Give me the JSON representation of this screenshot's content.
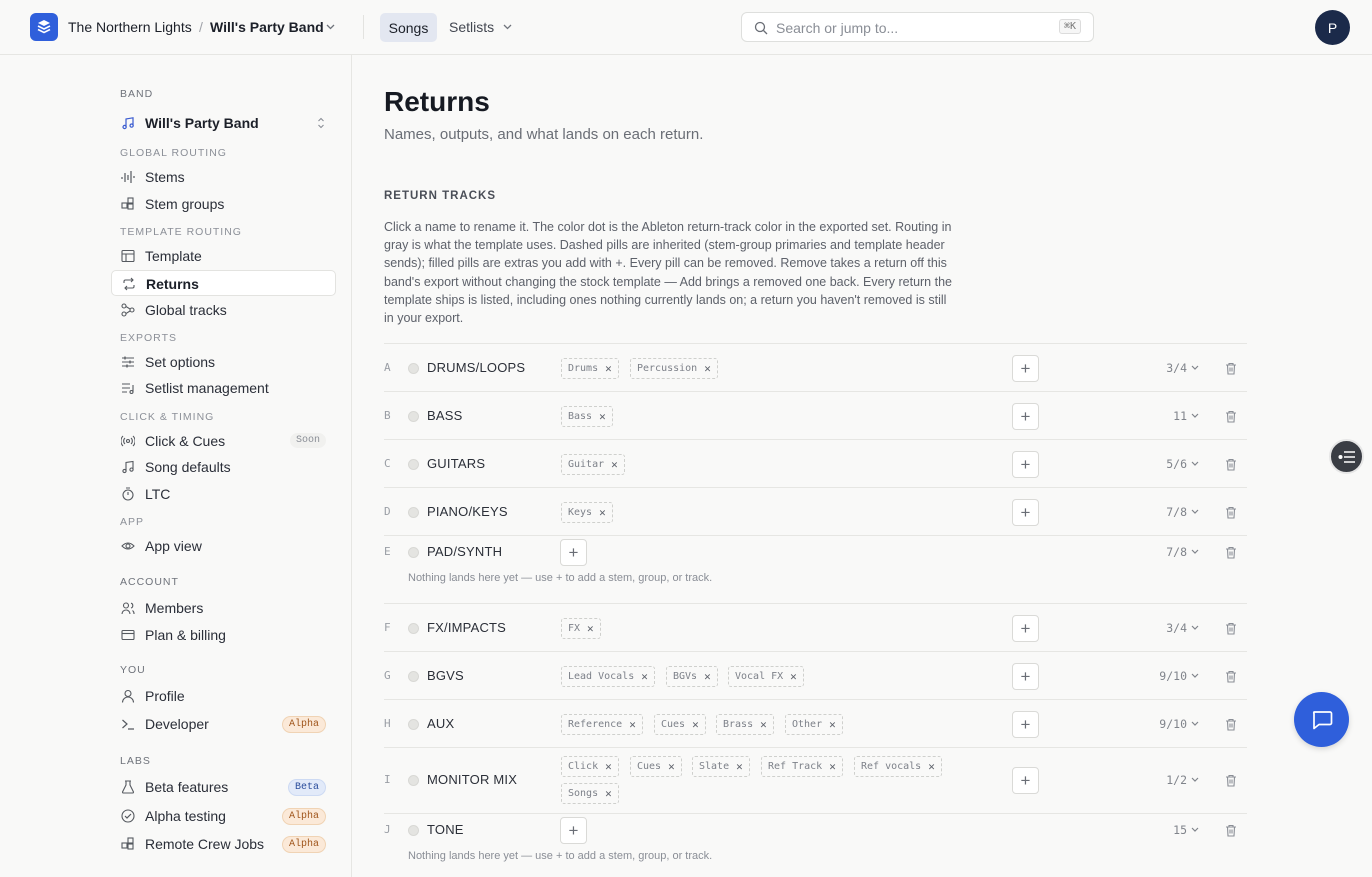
{
  "header": {
    "org": "The Northern Lights",
    "separator": "/",
    "band": "Will's Party Band",
    "tabs": [
      {
        "label": "Songs",
        "active": true
      },
      {
        "label": "Setlists",
        "active": false
      }
    ],
    "search_placeholder": "Search or jump to...",
    "search_shortcut": "⌘K",
    "avatar_initial": "P"
  },
  "sidebar": {
    "band_label": "BAND",
    "band_name": "Will's Party Band",
    "sections": {
      "global_routing": "GLOBAL ROUTING",
      "template_routing": "TEMPLATE ROUTING",
      "exports": "EXPORTS",
      "click_timing": "CLICK & TIMING",
      "app": "APP",
      "account": "ACCOUNT",
      "you": "YOU",
      "labs": "LABS"
    },
    "items": {
      "stems": "Stems",
      "stem_groups": "Stem groups",
      "template": "Template",
      "returns": "Returns",
      "global_tracks": "Global tracks",
      "set_options": "Set options",
      "setlist_management": "Setlist management",
      "click_cues": "Click & Cues",
      "song_defaults": "Song defaults",
      "ltc": "LTC",
      "app_view": "App view",
      "members": "Members",
      "plan_billing": "Plan & billing",
      "profile": "Profile",
      "developer": "Developer",
      "beta_features": "Beta features",
      "alpha_testing": "Alpha testing",
      "remote_crew_jobs": "Remote Crew Jobs"
    },
    "badges": {
      "soon": "Soon",
      "alpha": "Alpha",
      "beta": "Beta"
    }
  },
  "main": {
    "title": "Returns",
    "subtitle": "Names, outputs, and what lands on each return.",
    "section_title": "RETURN TRACKS",
    "description": "Click a name to rename it. The color dot is the Ableton return-track color in the exported set. Routing in gray is what the template uses. Dashed pills are inherited (stem-group primaries and template header sends); filled pills are extras you add with +. Every pill can be removed. Remove takes a return off this band's export without changing the stock template — Add brings a removed one back. Every return the template ships is listed, including ones nothing currently lands on; a return you haven't removed is still in your export.",
    "empty_note": "Nothing lands here yet — use + to add a stem, group, or track.",
    "returns": [
      {
        "letter": "A",
        "name": "DRUMS/LOOPS",
        "pills": [
          "Drums",
          "Percussion"
        ],
        "output": "3/4"
      },
      {
        "letter": "B",
        "name": "BASS",
        "pills": [
          "Bass"
        ],
        "output": "11"
      },
      {
        "letter": "C",
        "name": "GUITARS",
        "pills": [
          "Guitar"
        ],
        "output": "5/6"
      },
      {
        "letter": "D",
        "name": "PIANO/KEYS",
        "pills": [
          "Keys"
        ],
        "output": "7/8"
      },
      {
        "letter": "E",
        "name": "PAD/SYNTH",
        "pills": [],
        "output": "7/8"
      },
      {
        "letter": "F",
        "name": "FX/IMPACTS",
        "pills": [
          "FX"
        ],
        "output": "3/4"
      },
      {
        "letter": "G",
        "name": "BGVS",
        "pills": [
          "Lead Vocals",
          "BGVs",
          "Vocal FX"
        ],
        "output": "9/10"
      },
      {
        "letter": "H",
        "name": "AUX",
        "pills": [
          "Reference",
          "Cues",
          "Brass",
          "Other"
        ],
        "output": "9/10"
      },
      {
        "letter": "I",
        "name": "MONITOR MIX",
        "pills": [
          "Click",
          "Cues",
          "Slate",
          "Ref Track",
          "Ref vocals",
          "Songs"
        ],
        "output": "1/2"
      },
      {
        "letter": "J",
        "name": "TONE",
        "pills": [],
        "output": "15"
      }
    ]
  },
  "colors": {
    "accent": "#2f5fdb",
    "active_tab_bg": "#e3e7f1",
    "alpha_badge": "#fbe9d8",
    "beta_badge": "#e2eaf9"
  }
}
